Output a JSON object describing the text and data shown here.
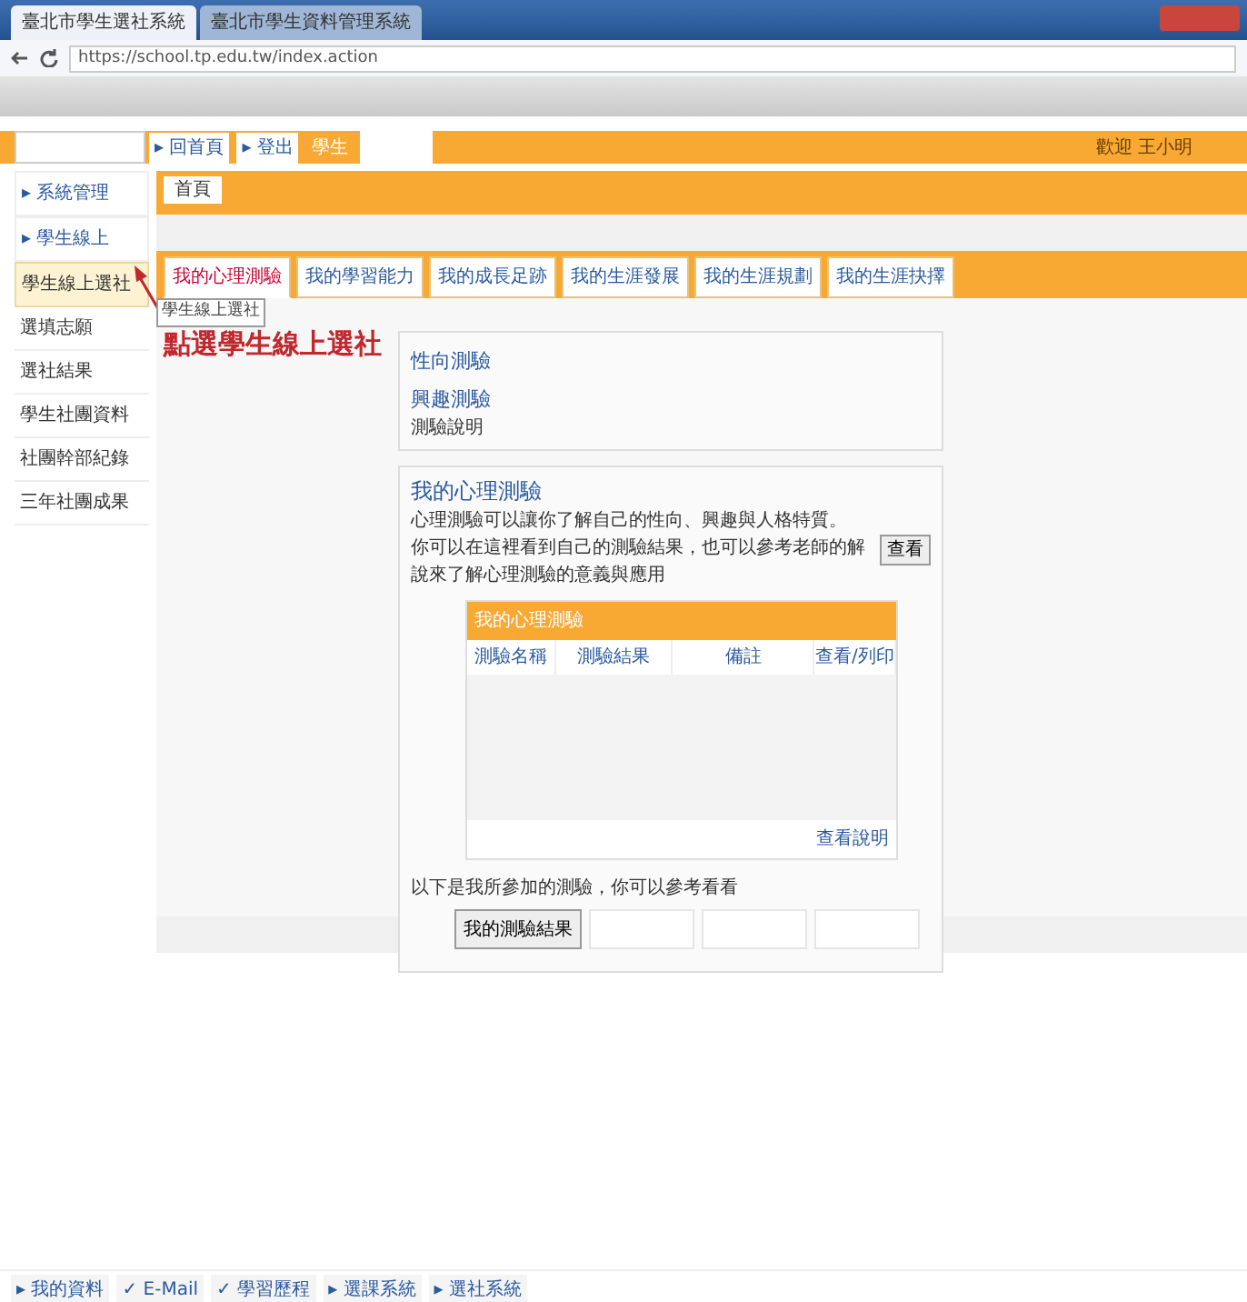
{
  "browser": {
    "tabs": [
      {
        "label": "臺北市學生選社系統",
        "selected": true
      },
      {
        "label": "臺北市學生資料管理系統",
        "selected": false
      }
    ],
    "url": "https://school.tp.edu.tw/index.action"
  },
  "topbar": {
    "links": [
      {
        "label": "▸ 回首頁",
        "selected": false
      },
      {
        "label": "▸ 登出",
        "selected": false
      },
      {
        "label": "學生",
        "selected": true
      }
    ],
    "user": "歡迎 王小明"
  },
  "sidebar": {
    "items": [
      {
        "label": "▸ 系統管理",
        "kind": "group",
        "selected": false
      },
      {
        "label": "▸ 學生線上",
        "kind": "group",
        "selected": false
      },
      {
        "label": "學生線上選社",
        "kind": "item",
        "selected": true
      },
      {
        "label": "選填志願",
        "kind": "item",
        "selected": false
      },
      {
        "label": "選社結果",
        "kind": "item",
        "selected": false
      },
      {
        "label": "學生社團資料",
        "kind": "item",
        "selected": false
      },
      {
        "label": "社團幹部紀錄",
        "kind": "item",
        "selected": false
      },
      {
        "label": "三年社團成果",
        "kind": "item",
        "selected": false
      }
    ],
    "tooltip": "學生線上選社"
  },
  "breadcrumb": "首頁",
  "tabs": [
    {
      "label": "我的心理測驗",
      "selected": true
    },
    {
      "label": "我的學習能力",
      "selected": false
    },
    {
      "label": "我的成長足跡",
      "selected": false
    },
    {
      "label": "我的生涯發展",
      "selected": false
    },
    {
      "label": "我的生涯規劃",
      "selected": false
    },
    {
      "label": "我的生涯抉擇",
      "selected": false
    }
  ],
  "annotation": "點選學生線上選社",
  "tests_panel": {
    "links": [
      "性向測驗",
      "興趣測驗"
    ],
    "note": "測驗說明"
  },
  "psych_panel": {
    "title": "我的心理測驗",
    "lines": [
      "心理測驗可以讓你了解自己的性向、興趣與人格特質。",
      "你可以在這裡看到自己的測驗結果，也可以參考老師的解說來了解心理測驗的意義與應用",
      "查看"
    ],
    "table": {
      "title": "我的心理測驗",
      "columns": [
        "測驗名稱",
        "測驗結果",
        "備註",
        "查看/列印"
      ],
      "footer": "查看說明"
    },
    "result_note": "以下是我所參加的測驗，你可以參考看看",
    "result_button": "我的測驗結果"
  },
  "taskbar": [
    "▸ 我的資料",
    "✓ E-Mail",
    "✓ 學習歷程",
    "▸ 選課系統",
    "▸ 選社系統"
  ]
}
